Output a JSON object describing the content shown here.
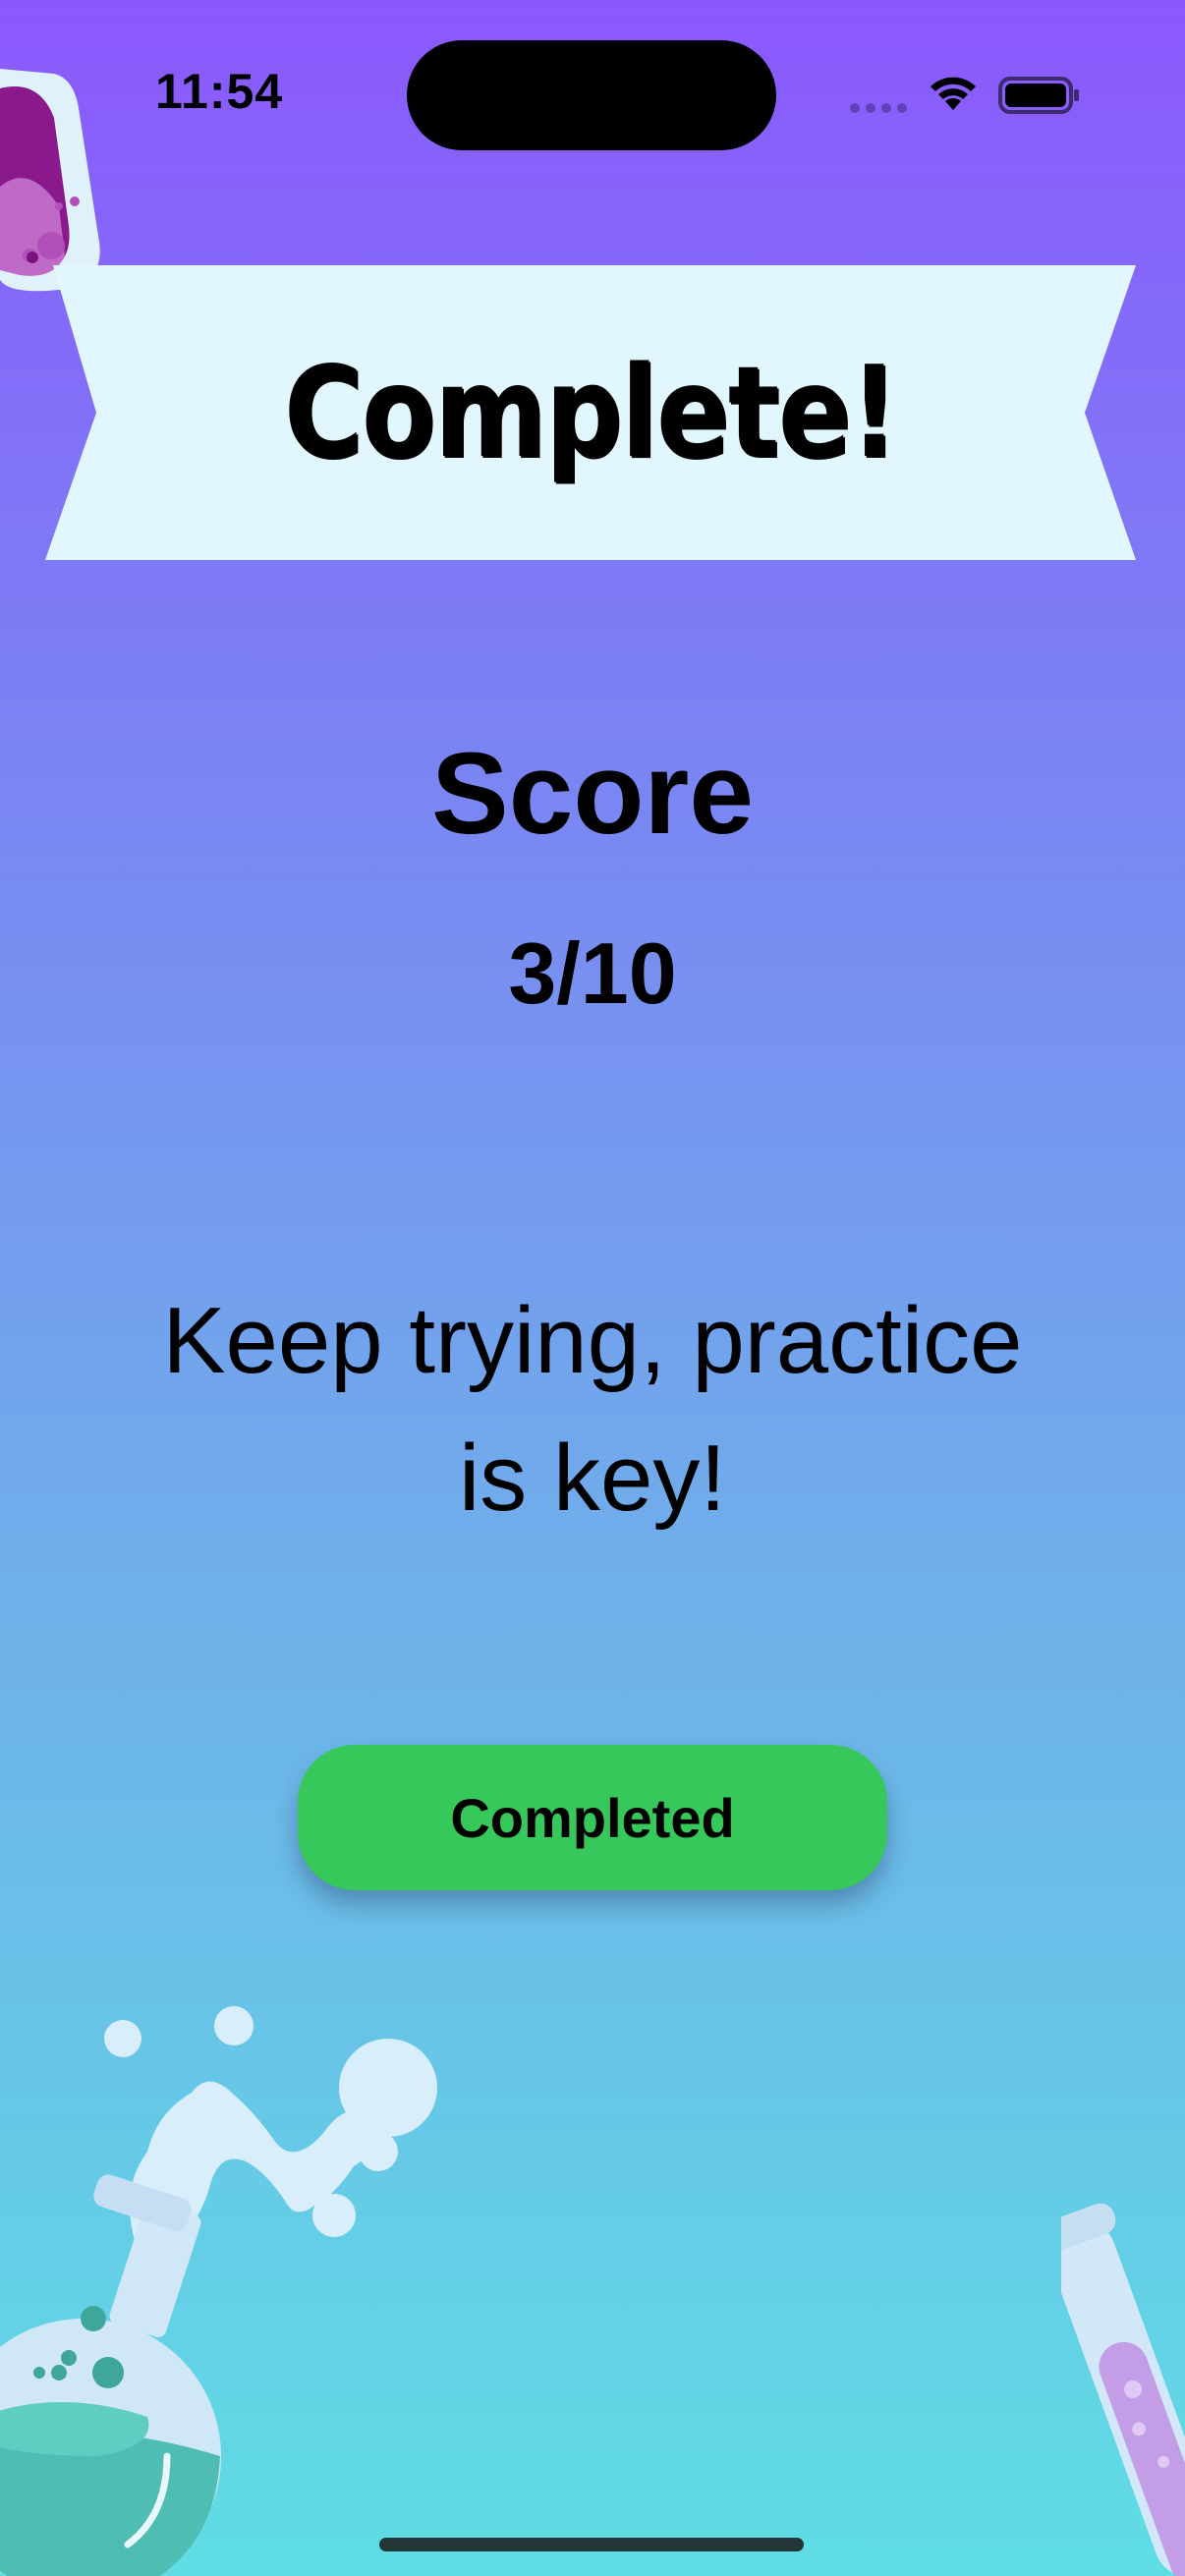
{
  "status_bar": {
    "time": "11:54",
    "icons": [
      "cellular-signal-icon",
      "wifi-icon",
      "battery-icon"
    ]
  },
  "banner": {
    "title": "Complete!"
  },
  "score": {
    "heading": "Score",
    "value": "3/10",
    "correct": 3,
    "total": 10
  },
  "message": "Keep trying, practice is key!",
  "button": {
    "label": "Completed"
  },
  "decorations": [
    "beaker-icon",
    "round-flask-icon",
    "test-tube-icon"
  ],
  "colors": {
    "gradient_top": "#8b58fd",
    "gradient_bottom": "#5fdde4",
    "banner": "#e2f6fe",
    "button": "#36c85a"
  }
}
